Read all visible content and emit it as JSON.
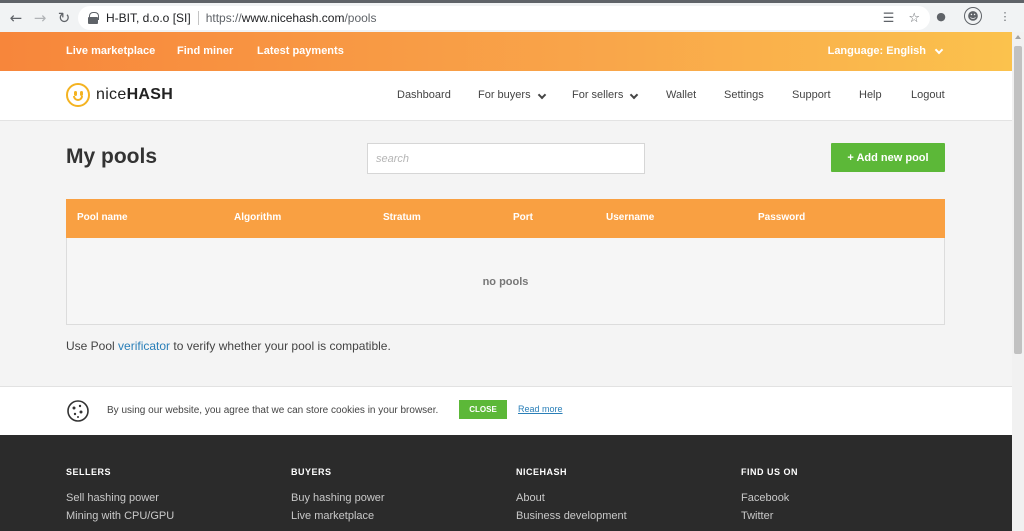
{
  "browser": {
    "site_identity": "H-BIT, d.o.o [SI]",
    "url_scheme": "https://",
    "url_host": "www.nicehash.com",
    "url_path": "/pools"
  },
  "topbar": {
    "links": [
      "Live marketplace",
      "Find miner",
      "Latest payments"
    ],
    "language_label": "Language: English"
  },
  "nav": {
    "logo_part1": "nice",
    "logo_part2": "HASH",
    "items": [
      "Dashboard",
      "For buyers",
      "For sellers",
      "Wallet",
      "Settings",
      "Support",
      "Help",
      "Logout"
    ]
  },
  "main": {
    "title": "My pools",
    "search_placeholder": "search",
    "add_button": "+ Add new pool",
    "table_headers": [
      "Pool name",
      "Algorithm",
      "Stratum",
      "Port",
      "Username",
      "Password"
    ],
    "empty_text": "no pools",
    "verify_prefix": "Use Pool ",
    "verify_link": "verificator",
    "verify_suffix": " to verify whether your pool is compatible."
  },
  "cookie": {
    "text": "By using our website, you agree that we can store cookies in your browser.",
    "close_label": "CLOSE",
    "read_more": "Read more"
  },
  "footer": {
    "columns": [
      {
        "title": "SELLERS",
        "links": [
          "Sell hashing power",
          "Mining with CPU/GPU"
        ]
      },
      {
        "title": "BUYERS",
        "links": [
          "Buy hashing power",
          "Live marketplace"
        ]
      },
      {
        "title": "NICEHASH",
        "links": [
          "About",
          "Business development"
        ]
      },
      {
        "title": "FIND US ON",
        "links": [
          "Facebook",
          "Twitter"
        ]
      }
    ]
  },
  "colors": {
    "orange": "#f7863b",
    "green": "#5cb838",
    "link_blue": "#2a7fb8",
    "footer_bg": "#2b2b2b"
  }
}
